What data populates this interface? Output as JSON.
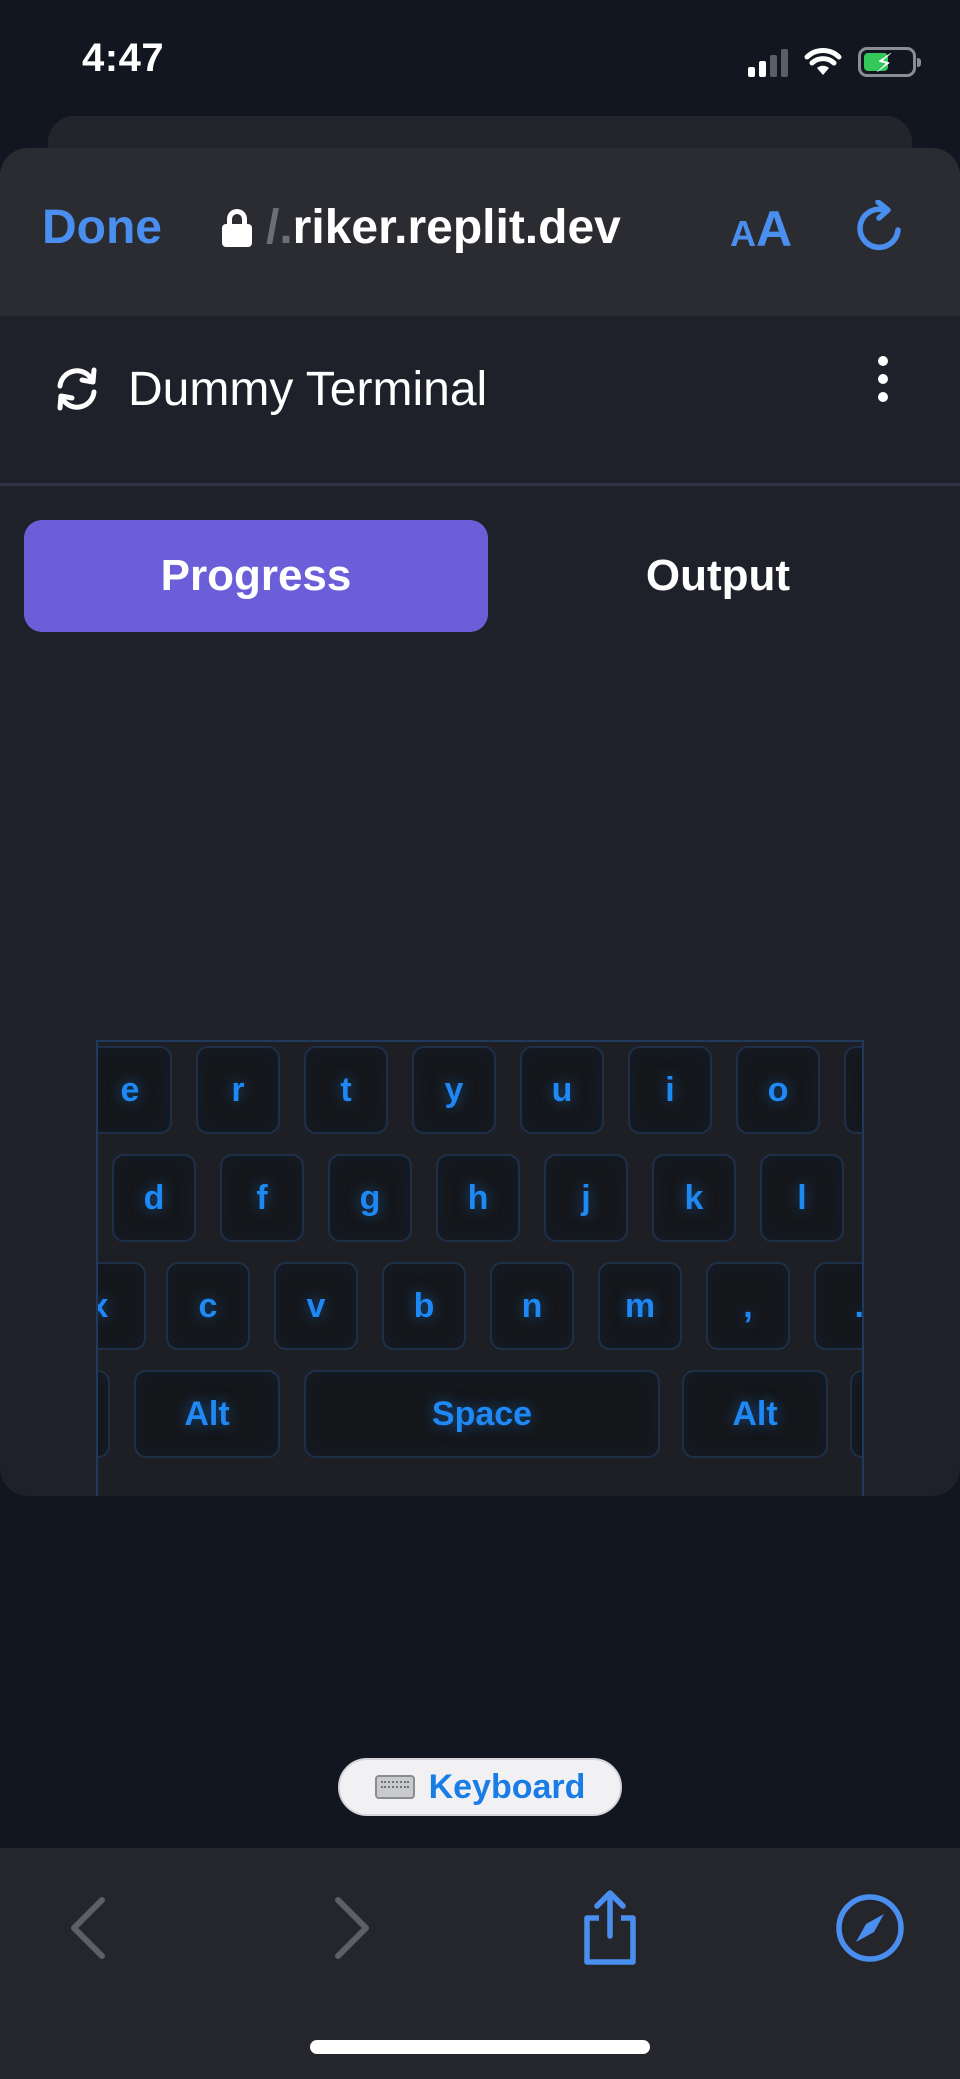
{
  "status_bar": {
    "time": "4:47",
    "icons": [
      "signal-icon",
      "wifi-icon",
      "battery-charging-icon"
    ]
  },
  "browser": {
    "done_label": "Done",
    "url_faded_prefix": "/.",
    "url_text": "riker.replit.dev",
    "text_size_small": "A",
    "text_size_big": "A",
    "accent_color": "#4a8ff0"
  },
  "app": {
    "title": "Dummy Terminal",
    "tabs": [
      {
        "label": "Progress",
        "active": true
      },
      {
        "label": "Output",
        "active": false
      }
    ],
    "active_tab_color": "#6b5fd9"
  },
  "keyboard": {
    "row1": [
      "e",
      "r",
      "t",
      "y",
      "u",
      "i",
      "o"
    ],
    "row2": [
      "d",
      "f",
      "g",
      "h",
      "j",
      "k",
      "l"
    ],
    "row3": [
      "x",
      "c",
      "v",
      "b",
      "n",
      "m",
      ",",
      "."
    ],
    "row4": [
      "Alt",
      "Space",
      "Alt"
    ],
    "key_color": "#1e88f5"
  },
  "keyboard_toggle": {
    "label": "Keyboard"
  }
}
